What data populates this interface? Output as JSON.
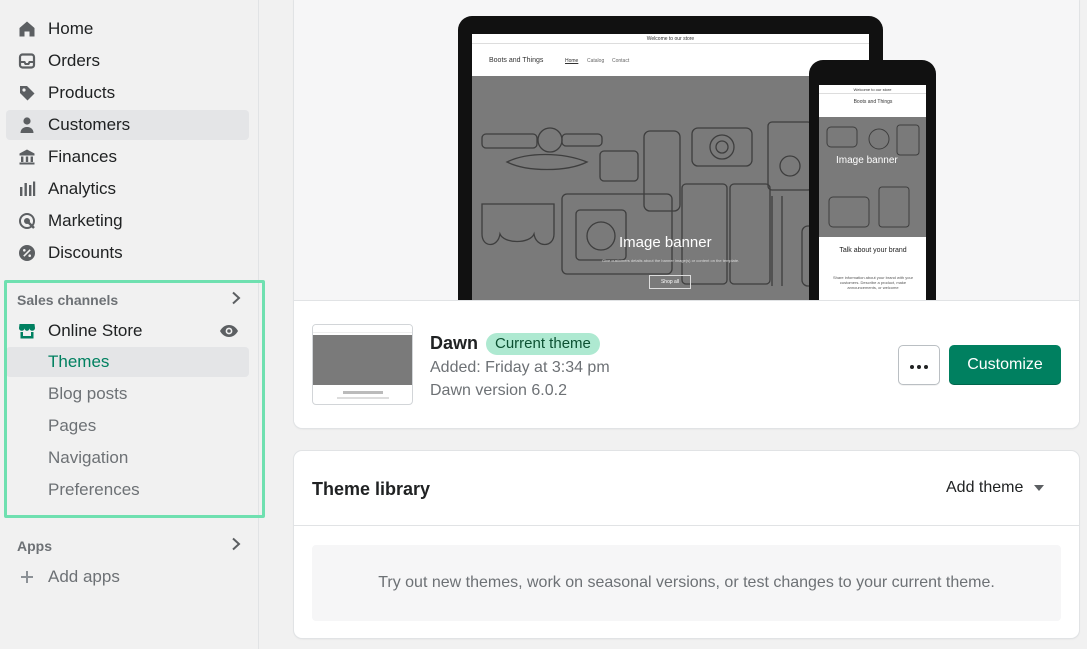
{
  "sidebar": {
    "items": [
      {
        "label": "Home",
        "icon": "home-icon"
      },
      {
        "label": "Orders",
        "icon": "orders-icon"
      },
      {
        "label": "Products",
        "icon": "tag-icon"
      },
      {
        "label": "Customers",
        "icon": "person-icon"
      },
      {
        "label": "Finances",
        "icon": "bank-icon"
      },
      {
        "label": "Analytics",
        "icon": "bar-chart-icon"
      },
      {
        "label": "Marketing",
        "icon": "target-icon"
      },
      {
        "label": "Discounts",
        "icon": "discount-icon"
      }
    ],
    "sales_channels_label": "Sales channels",
    "online_store_label": "Online Store",
    "online_store_sub": [
      "Themes",
      "Blog posts",
      "Pages",
      "Navigation",
      "Preferences"
    ],
    "apps_label": "Apps",
    "add_apps_label": "Add apps"
  },
  "current_theme": {
    "name": "Dawn",
    "badge": "Current theme",
    "added": "Added: Friday at 3:34 pm",
    "version": "Dawn version 6.0.2",
    "customize_label": "Customize",
    "more_label": "•••"
  },
  "preview": {
    "laptop_announcement": "Welcome to our store",
    "laptop_store_name": "Boots and Things",
    "laptop_nav": [
      "Home",
      "Catalog",
      "Contact"
    ],
    "banner_title": "Image banner",
    "banner_sub": "Give customers details about the banner image(s) or content on the template.",
    "shop_all": "Shop all",
    "phone_announcement": "Welcome to our store",
    "phone_store_name": "Boots and Things",
    "phone_banner_title": "Image banner",
    "phone_text_title": "Talk about your brand",
    "phone_text_body": "Share information about your brand with your customers. Describe a product, make announcements, or welcome"
  },
  "library": {
    "title": "Theme library",
    "add_theme_label": "Add theme",
    "empty_text": "Try out new themes, work on seasonal versions, or test changes to your current theme."
  },
  "colors": {
    "accent": "#008060",
    "badge_bg": "#aee9d1",
    "highlight": "#6fe0b0"
  }
}
